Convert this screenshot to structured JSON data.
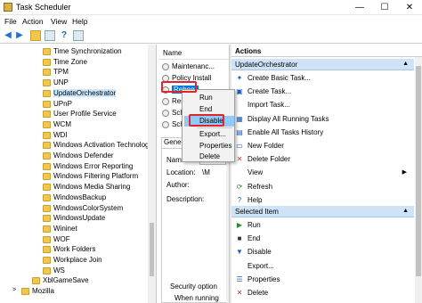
{
  "window": {
    "title": "Task Scheduler",
    "min": "—",
    "max": "☐",
    "close": "✕"
  },
  "menu": [
    "File",
    "Action",
    "View",
    "Help"
  ],
  "tree": {
    "items": [
      {
        "label": "Time Synchronization",
        "indent": 1
      },
      {
        "label": "Time Zone",
        "indent": 1
      },
      {
        "label": "TPM",
        "indent": 1
      },
      {
        "label": "UNP",
        "indent": 1
      },
      {
        "label": "UpdateOrchestrator",
        "indent": 1,
        "selected": true
      },
      {
        "label": "UPnP",
        "indent": 1
      },
      {
        "label": "User Profile Service",
        "indent": 1
      },
      {
        "label": "WCM",
        "indent": 1
      },
      {
        "label": "WDI",
        "indent": 1
      },
      {
        "label": "Windows Activation Technologi",
        "indent": 1
      },
      {
        "label": "Windows Defender",
        "indent": 1
      },
      {
        "label": "Windows Error Reporting",
        "indent": 1
      },
      {
        "label": "Windows Filtering Platform",
        "indent": 1
      },
      {
        "label": "Windows Media Sharing",
        "indent": 1
      },
      {
        "label": "WindowsBackup",
        "indent": 1
      },
      {
        "label": "WindowsColorSystem",
        "indent": 1
      },
      {
        "label": "WindowsUpdate",
        "indent": 1
      },
      {
        "label": "Wininet",
        "indent": 1
      },
      {
        "label": "WOF",
        "indent": 1
      },
      {
        "label": "Work Folders",
        "indent": 1
      },
      {
        "label": "Workplace Join",
        "indent": 1
      },
      {
        "label": "WS",
        "indent": 1
      },
      {
        "label": "XblGameSave",
        "indent": 0
      },
      {
        "label": "Mozilla",
        "indent": -1
      }
    ]
  },
  "tasks": {
    "header": "Name",
    "rows": [
      "Maintenanc...",
      "Policy Install",
      "Reboot",
      "Resc",
      "Sch",
      "Sch"
    ]
  },
  "general": {
    "tab": "Gener",
    "name_label": "Name:",
    "location_label": "Location:",
    "location_value": "\\M",
    "author_label": "Author:",
    "description_label": "Description:",
    "security_label": "Security option",
    "when_running": "When running"
  },
  "context_menu": {
    "items": [
      "Run",
      "End",
      "Disable",
      "Export...",
      "Properties",
      "Delete"
    ],
    "highlighted": "Disable"
  },
  "actions": {
    "header": "Actions",
    "section1": "UpdateOrchestrator",
    "items1": [
      {
        "label": "Create Basic Task...",
        "icon": "create-basic-task-icon",
        "glyph": "✦"
      },
      {
        "label": "Create Task...",
        "icon": "create-task-icon",
        "glyph": "▣"
      },
      {
        "label": "Import Task...",
        "icon": "import-icon",
        "glyph": ""
      },
      {
        "label": "Display All Running Tasks",
        "icon": "running-tasks-icon",
        "glyph": "▦"
      },
      {
        "label": "Enable All Tasks History",
        "icon": "history-icon",
        "glyph": "▤"
      },
      {
        "label": "New Folder",
        "icon": "new-folder-icon",
        "glyph": "▭"
      },
      {
        "label": "Delete Folder",
        "icon": "delete-folder-icon",
        "glyph": "✕"
      },
      {
        "label": "View",
        "icon": "",
        "glyph": "",
        "submenu": true
      },
      {
        "label": "Refresh",
        "icon": "refresh-icon",
        "glyph": "⟳"
      },
      {
        "label": "Help",
        "icon": "help-icon",
        "glyph": "?"
      }
    ],
    "section2": "Selected Item",
    "items2": [
      {
        "label": "Run",
        "icon": "run-icon",
        "glyph": "▶"
      },
      {
        "label": "End",
        "icon": "end-icon",
        "glyph": "■"
      },
      {
        "label": "Disable",
        "icon": "disable-icon",
        "glyph": "▼"
      },
      {
        "label": "Export...",
        "icon": "",
        "glyph": ""
      },
      {
        "label": "Properties",
        "icon": "properties-icon",
        "glyph": "☰"
      },
      {
        "label": "Delete",
        "icon": "delete-icon",
        "glyph": "✕"
      }
    ]
  },
  "colors": {
    "section": "#cfe3f7",
    "selected": "#0078d7",
    "highlight": "#91c9f7",
    "annotation": "#e0262b"
  }
}
